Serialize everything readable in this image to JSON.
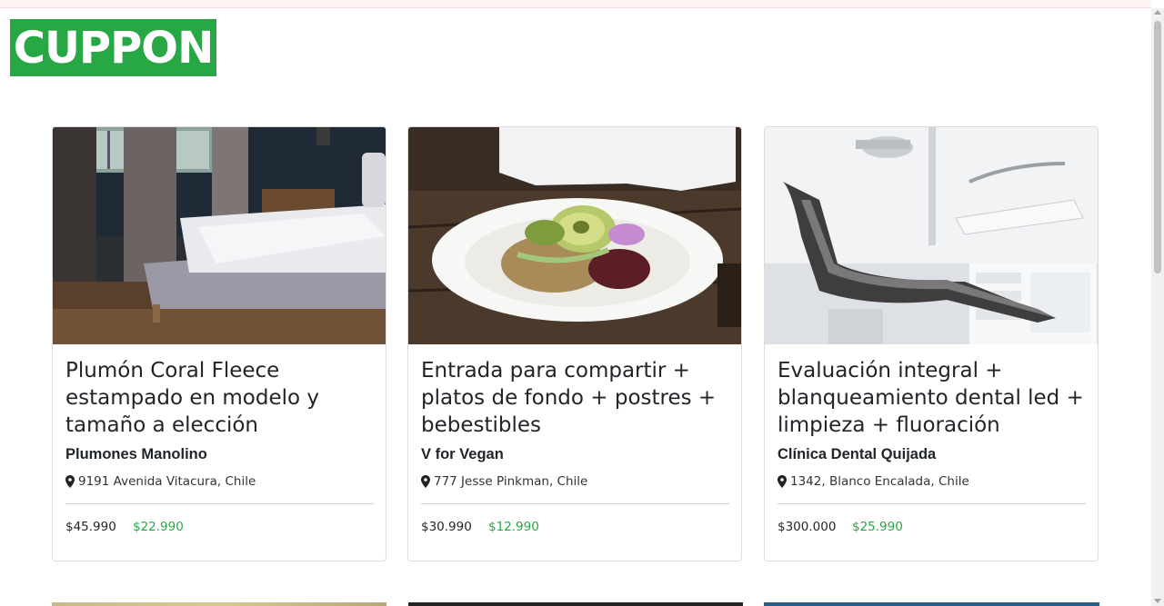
{
  "brand": {
    "logo_text": "CUPPON",
    "logo_color": "#28a745"
  },
  "colors": {
    "price_discount": "#28a745",
    "text": "#212529"
  },
  "cards": [
    {
      "image": "bedroom-bed-photo",
      "title": "Plumón Coral Fleece estampado en modelo y tamaño a elección",
      "company": "Plumones Manolino",
      "address": "9191 Avenida Vitacura, Chile",
      "price_original": "$45.990",
      "price_discount": "$22.990"
    },
    {
      "image": "vegan-salad-plate-photo",
      "title": "Entrada para compartir + platos de fondo + postres + bebestibles",
      "company": "V for Vegan",
      "address": "777 Jesse Pinkman, Chile",
      "price_original": "$30.990",
      "price_discount": "$12.990"
    },
    {
      "image": "dental-chair-photo",
      "title": "Evaluación integral + blanqueamiento dental led + limpieza + fluoración",
      "company": "Clínica Dental Quijada",
      "address": "1342, Blanco Encalada, Chile",
      "price_original": "$300.000",
      "price_discount": "$25.990"
    }
  ]
}
